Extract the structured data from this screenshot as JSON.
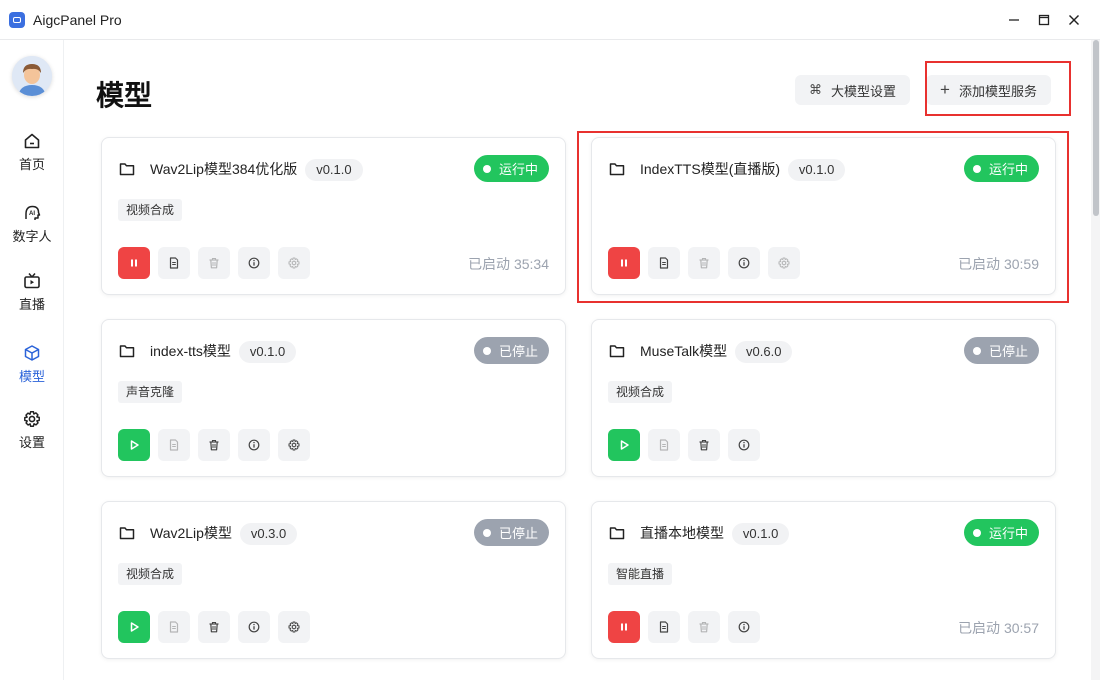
{
  "window": {
    "title": "AigcPanel Pro"
  },
  "sidebar": {
    "items": [
      {
        "label": "首页",
        "icon": "home-icon"
      },
      {
        "label": "数字人",
        "icon": "ai-head-icon"
      },
      {
        "label": "直播",
        "icon": "tv-icon"
      },
      {
        "label": "模型",
        "icon": "cube-icon",
        "active": true
      },
      {
        "label": "设置",
        "icon": "gear-icon"
      }
    ]
  },
  "header": {
    "title": "模型",
    "llm_settings_label": "大模型设置",
    "llm_settings_icon": "command-icon",
    "add_service_label": "添加模型服务",
    "add_service_icon": "plus-icon"
  },
  "cards": [
    {
      "name": "Wav2Lip模型384优化版",
      "version": "v0.1.0",
      "status": "运行中",
      "running": true,
      "tag": "视频合成",
      "uptime": "已启动 35:34"
    },
    {
      "name": "IndexTTS模型(直播版)",
      "version": "v0.1.0",
      "status": "运行中",
      "running": true,
      "tag": "",
      "uptime": "已启动 30:59"
    },
    {
      "name": "index-tts模型",
      "version": "v0.1.0",
      "status": "已停止",
      "running": false,
      "tag": "声音克隆",
      "uptime": ""
    },
    {
      "name": "MuseTalk模型",
      "version": "v0.6.0",
      "status": "已停止",
      "running": false,
      "tag": "视频合成",
      "uptime": ""
    },
    {
      "name": "Wav2Lip模型",
      "version": "v0.3.0",
      "status": "已停止",
      "running": false,
      "tag": "视频合成",
      "uptime": ""
    },
    {
      "name": "直播本地模型",
      "version": "v0.1.0",
      "status": "运行中",
      "running": true,
      "tag": "智能直播",
      "uptime": "已启动 30:57"
    }
  ],
  "colors": {
    "accent": "#2b63d9",
    "running": "#22c55e",
    "stopped": "#9ca3af",
    "stop_button": "#ef4444",
    "highlight_box": "#e8312f"
  }
}
